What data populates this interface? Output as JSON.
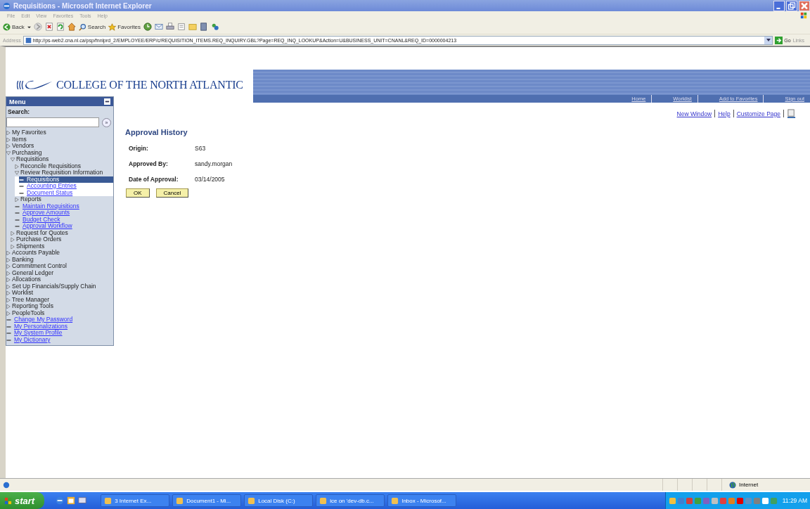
{
  "window": {
    "title": "Requisitions - Microsoft Internet Explorer"
  },
  "menu_bar": [
    "File",
    "Edit",
    "View",
    "Favorites",
    "Tools",
    "Help"
  ],
  "toolbar": {
    "back": "Back",
    "search": "Search",
    "favorites": "Favorites"
  },
  "address_bar": {
    "label": "Address",
    "url": "http://ps-web2.cna.nl.ca/psp/fnnlprd_2/EMPLOYEE/ERP/c/REQUISITION_ITEMS.REQ_INQUIRY.GBL?Page=REQ_INQ_LOOKUP&Action=U&BUSINESS_UNIT=CNANL&REQ_ID=0000004213",
    "go": "Go",
    "links": "Links"
  },
  "banner": {
    "logo_text": "COLLEGE OF THE NORTH ATLANTIC",
    "nav": [
      "Home",
      "Worklist",
      "Add to Favorites",
      "Sign out"
    ]
  },
  "page_links": [
    "New Window",
    "Help",
    "Customize Page"
  ],
  "sidebar": {
    "title": "Menu",
    "search_label": "Search:",
    "search_button": "»",
    "items": [
      {
        "label": "My Favorites",
        "kind": "folder",
        "expanded": false,
        "selected": false
      },
      {
        "label": "Items",
        "kind": "folder",
        "expanded": false,
        "selected": false
      },
      {
        "label": "Vendors",
        "kind": "folder",
        "expanded": false,
        "selected": false
      },
      {
        "label": "Purchasing",
        "kind": "folder",
        "expanded": true,
        "selected": false,
        "children": [
          {
            "label": "Requisitions",
            "kind": "folder",
            "expanded": true,
            "selected": false,
            "children": [
              {
                "label": "Reconcile Requisitions",
                "kind": "folder",
                "expanded": false,
                "selected": false
              },
              {
                "label": "Review Requisition Information",
                "kind": "folder",
                "expanded": true,
                "selected": false,
                "children": [
                  {
                    "label": "Requisitions",
                    "kind": "link",
                    "selected": true
                  },
                  {
                    "label": "Accounting Entries",
                    "kind": "link",
                    "selected": false
                  },
                  {
                    "label": "Document Status",
                    "kind": "link",
                    "selected": false
                  }
                ]
              },
              {
                "label": "Reports",
                "kind": "folder",
                "expanded": false,
                "selected": false
              },
              {
                "label": "Maintain Requisitions",
                "kind": "link",
                "selected": false
              },
              {
                "label": "Approve Amounts",
                "kind": "link",
                "selected": false
              },
              {
                "label": "Budget Check",
                "kind": "link",
                "selected": false
              },
              {
                "label": "Approval Workflow",
                "kind": "link",
                "selected": false
              }
            ]
          },
          {
            "label": "Request for Quotes",
            "kind": "folder",
            "expanded": false,
            "selected": false
          },
          {
            "label": "Purchase Orders",
            "kind": "folder",
            "expanded": false,
            "selected": false
          },
          {
            "label": "Shipments",
            "kind": "folder",
            "expanded": false,
            "selected": false
          }
        ]
      },
      {
        "label": "Accounts Payable",
        "kind": "folder",
        "expanded": false,
        "selected": false
      },
      {
        "label": "Banking",
        "kind": "folder",
        "expanded": false,
        "selected": false
      },
      {
        "label": "Commitment Control",
        "kind": "folder",
        "expanded": false,
        "selected": false
      },
      {
        "label": "General Ledger",
        "kind": "folder",
        "expanded": false,
        "selected": false
      },
      {
        "label": "Allocations",
        "kind": "folder",
        "expanded": false,
        "selected": false
      },
      {
        "label": "Set Up Financials/Supply Chain",
        "kind": "folder",
        "expanded": false,
        "selected": false
      },
      {
        "label": "Worklist",
        "kind": "folder",
        "expanded": false,
        "selected": false
      },
      {
        "label": "Tree Manager",
        "kind": "folder",
        "expanded": false,
        "selected": false
      },
      {
        "label": "Reporting Tools",
        "kind": "folder",
        "expanded": false,
        "selected": false
      },
      {
        "label": "PeopleTools",
        "kind": "folder",
        "expanded": false,
        "selected": false
      },
      {
        "label": "Change My Password",
        "kind": "link",
        "selected": false
      },
      {
        "label": "My Personalizations",
        "kind": "link",
        "selected": false
      },
      {
        "label": "My System Profile",
        "kind": "link",
        "selected": false
      },
      {
        "label": "My Dictionary",
        "kind": "link",
        "selected": false
      }
    ]
  },
  "content": {
    "title": "Approval History",
    "fields": [
      {
        "label": "Origin:",
        "value": "S63"
      },
      {
        "label": "Approved By:",
        "value": "sandy.morgan"
      },
      {
        "label": "Date of Approval:",
        "value": "03/14/2005"
      }
    ],
    "buttons": [
      "OK",
      "Cancel"
    ]
  },
  "status_bar": {
    "zone": "Internet"
  },
  "taskbar": {
    "start": "start",
    "tasks": [
      "3 Internet Ex...",
      "Document1 - Mi...",
      "Local Disk (C:)",
      "ice on 'dev-db.c...",
      "Inbox - Microsof..."
    ],
    "clock": "11:29 AM"
  }
}
